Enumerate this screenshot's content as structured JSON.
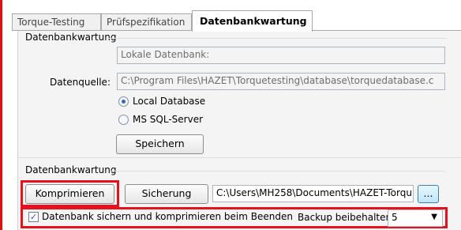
{
  "tabs": [
    {
      "label": "Torque-Testing"
    },
    {
      "label": "Prüfspezifikation"
    },
    {
      "label": "Datenbankwartung"
    }
  ],
  "db_group": {
    "title": "Datenbankwartung",
    "local_db_field": "Lokale Datenbank:",
    "source_label": "Datenquelle:",
    "source_path": "C:\\Program Files\\HAZET\\Torquetesting\\database\\torquedatabase.c",
    "radio_local": "Local Database",
    "radio_sql": "MS SQL-Server",
    "selected_source": "Local Database",
    "save_button": "Speichern"
  },
  "maintenance_group": {
    "title": "Datenbankwartung",
    "compress_button": "Komprimieren",
    "backup_button": "Sicherung",
    "backup_path": "C:\\Users\\MH258\\Documents\\HAZET-Torqu",
    "browse_button": "...",
    "auto_checkbox_label": "Datenbank sichern und komprimieren beim Beenden",
    "auto_checkbox_checked": true,
    "keep_backup_label": "Backup beibehalten",
    "keep_backup_value": "5"
  },
  "colors": {
    "highlight": "#e8101a",
    "radio_selected": "#2a6ad1"
  }
}
